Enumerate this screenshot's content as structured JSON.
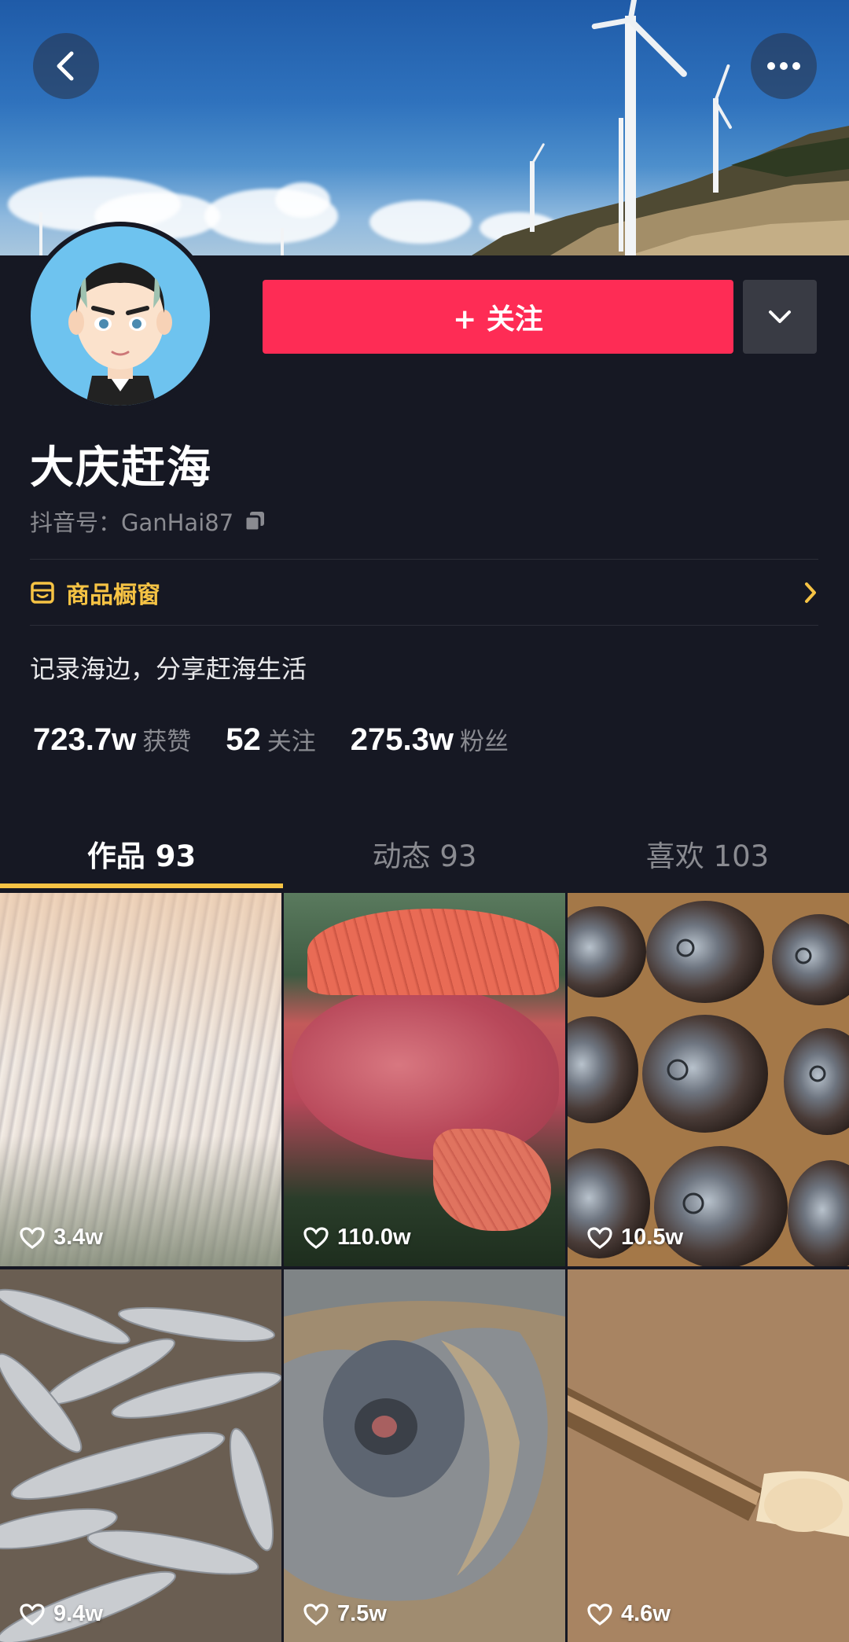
{
  "header": {
    "back_icon": "chevron-left-icon",
    "menu_icon": "more-horizontal-icon"
  },
  "profile": {
    "name": "大庆赶海",
    "douyin_id": "抖音号：GanHai87",
    "follow_label": "+ 关注",
    "shop_label": "商品橱窗",
    "bio": "记录海边，分享赶海生活"
  },
  "stats": [
    {
      "value": "723.7w",
      "label": "获赞"
    },
    {
      "value": "52",
      "label": "关注"
    },
    {
      "value": "275.3w",
      "label": "粉丝"
    }
  ],
  "tabs": [
    {
      "label": "作品 93",
      "active": true
    },
    {
      "label": "动态 93",
      "active": false
    },
    {
      "label": "喜欢 103",
      "active": false
    }
  ],
  "videos": [
    {
      "likes": "3.4w",
      "subject": "fish-fin"
    },
    {
      "likes": "110.0w",
      "subject": "red-rockfish"
    },
    {
      "likes": "10.5w",
      "subject": "moon-snails"
    },
    {
      "likes": "9.4w",
      "subject": "pile-of-fish"
    },
    {
      "likes": "7.5w",
      "subject": "fish-in-sand"
    },
    {
      "likes": "4.6w",
      "subject": "razor-clam"
    }
  ],
  "colors": {
    "background": "#161823",
    "follow": "#fe2c55",
    "accent": "#f6c344",
    "muted": "#8a8b91"
  }
}
